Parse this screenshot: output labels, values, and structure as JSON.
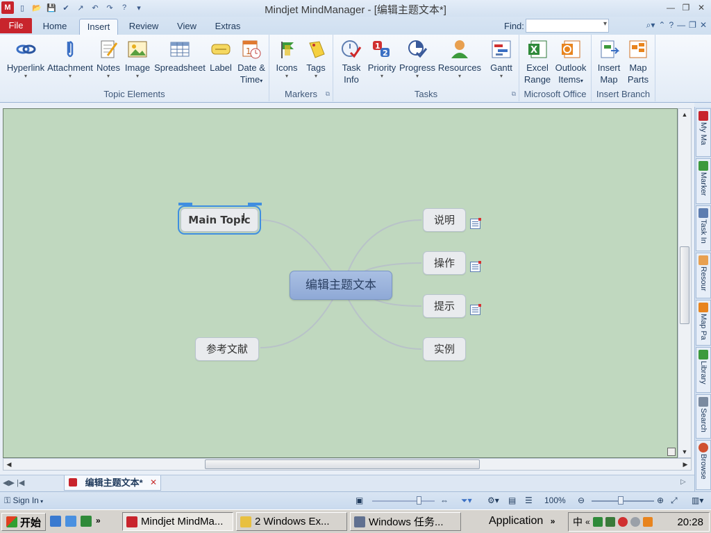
{
  "window": {
    "title": "Mindjet MindManager - [编辑主题文本*]",
    "controls": [
      "—",
      "❐",
      "✕"
    ]
  },
  "quick_access": [
    "M",
    "▯",
    "📂",
    "💾",
    "✔",
    "↗",
    "↶",
    "↷",
    "?",
    "▾"
  ],
  "ribbon_tabs": {
    "file": "File",
    "tabs": [
      "Home",
      "Insert",
      "Review",
      "View",
      "Extras"
    ],
    "active": "Insert",
    "find_label": "Find:",
    "find_value": ""
  },
  "ribbon": {
    "groups": [
      {
        "label": "Topic Elements",
        "buttons": [
          {
            "label": "Hyperlink",
            "icon": "hyperlink-icon"
          },
          {
            "label": "Attachment",
            "icon": "paperclip-icon"
          },
          {
            "label": "Notes",
            "icon": "notes-icon"
          },
          {
            "label": "Image",
            "icon": "image-icon"
          },
          {
            "label": "Spreadsheet",
            "icon": "spreadsheet-icon"
          },
          {
            "label": "Label",
            "icon": "label-icon"
          },
          {
            "label": "Date &",
            "label2": "Time",
            "icon": "calendar-icon"
          }
        ]
      },
      {
        "label": "Markers",
        "buttons": [
          {
            "label": "Icons",
            "icon": "flag-icon"
          },
          {
            "label": "Tags",
            "icon": "tag-icon"
          }
        ]
      },
      {
        "label": "Tasks",
        "buttons": [
          {
            "label": "Task",
            "label2": "Info",
            "icon": "task-clock-icon"
          },
          {
            "label": "Priority",
            "icon": "priority-icon"
          },
          {
            "label": "Progress",
            "icon": "progress-icon"
          },
          {
            "label": "Resources",
            "icon": "person-icon"
          },
          {
            "label": "Gantt",
            "icon": "gantt-icon"
          }
        ]
      },
      {
        "label": "Microsoft Office",
        "buttons": [
          {
            "label": "Excel",
            "label2": "Range",
            "icon": "excel-icon"
          },
          {
            "label": "Outlook",
            "label2": "Items",
            "icon": "outlook-icon"
          }
        ]
      },
      {
        "label": "Insert Branch",
        "buttons": [
          {
            "label": "Insert",
            "label2": "Map",
            "icon": "insert-map-icon"
          },
          {
            "label": "Map",
            "label2": "Parts",
            "icon": "map-parts-icon"
          }
        ]
      }
    ]
  },
  "map": {
    "central": "编辑主题文本",
    "left_topics": [
      "Main Topic",
      "参考文献"
    ],
    "right_topics": [
      "说明",
      "操作",
      "提示",
      "实例"
    ],
    "selected": "Main Topic",
    "background": "#c0d8bf"
  },
  "doc_tab": "编辑主题文本*",
  "side_panel": [
    "My Ma",
    "Marker",
    "Task In",
    "Resour",
    "Map Pa",
    "Library",
    "Search",
    "Browse"
  ],
  "status": {
    "sign_in": "Sign In",
    "zoom": "100%"
  },
  "taskbar": {
    "start": "开始",
    "buttons": [
      "Mindjet MindMa...",
      "2 Windows Ex...",
      "Windows 任务...",
      "Application"
    ],
    "clock": "20:28"
  },
  "colors": {
    "accent": "#c8242c",
    "ribbon_bg": "#e2ebf6",
    "central_topic": "#9bb3dc",
    "selection": "#3f8ee0"
  }
}
